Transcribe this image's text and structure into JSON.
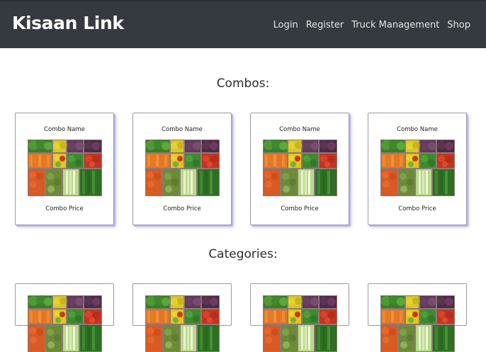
{
  "navbar": {
    "brand": "Kisaan Link",
    "links": [
      "Login",
      "Register",
      "Truck Management",
      "Shop"
    ]
  },
  "combos": {
    "title": "Combos:",
    "items": [
      {
        "name": "Combo Name",
        "price": "Combo Price",
        "image": "vegetable-crate-image"
      },
      {
        "name": "Combo Name",
        "price": "Combo Price",
        "image": "vegetable-crate-image"
      },
      {
        "name": "Combo Name",
        "price": "Combo Price",
        "image": "vegetable-crate-image"
      },
      {
        "name": "Combo Name",
        "price": "Combo Price",
        "image": "vegetable-crate-image"
      }
    ]
  },
  "categories": {
    "title": "Categories:",
    "items": [
      {
        "image": "vegetable-crate-image"
      },
      {
        "image": "vegetable-crate-image"
      },
      {
        "image": "vegetable-crate-image"
      },
      {
        "image": "vegetable-crate-image"
      }
    ]
  },
  "colors": {
    "navbar_bg": "#343a40",
    "card_shadow": "#b9b7e6"
  }
}
